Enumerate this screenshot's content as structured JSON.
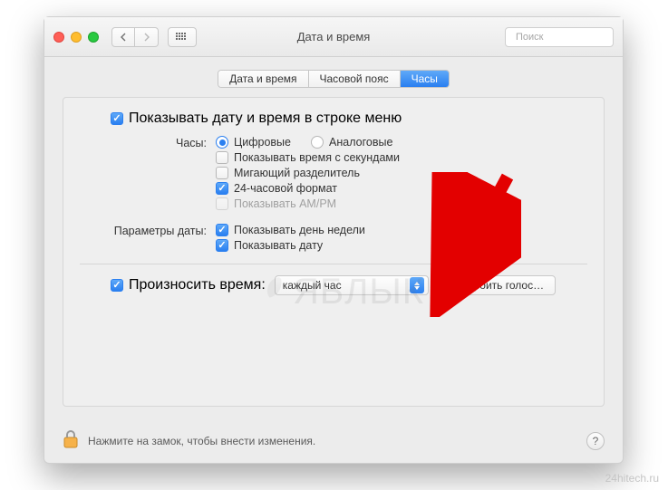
{
  "window": {
    "title": "Дата и время"
  },
  "search": {
    "placeholder": "Поиск"
  },
  "tabs": {
    "items": [
      "Дата и время",
      "Часовой пояс",
      "Часы"
    ],
    "active_index": 2
  },
  "menubar": {
    "show_label": "Показывать дату и время в строке меню"
  },
  "clock": {
    "label": "Часы:",
    "digital_label": "Цифровые",
    "analog_label": "Аналоговые",
    "show_seconds_label": "Показывать время с секундами",
    "flash_separators_label": "Мигающий разделитель",
    "twentyfour_label": "24-часовой формат",
    "ampm_label": "Показывать AM/PM"
  },
  "date": {
    "label": "Параметры даты:",
    "show_weekday_label": "Показывать день недели",
    "show_date_label": "Показывать дату"
  },
  "speak": {
    "announce_label": "Произносить время:",
    "interval_selected": "каждый час",
    "customize_button": "Настроить голос…"
  },
  "footer": {
    "lock_hint": "Нажмите на замок, чтобы внести изменения."
  },
  "watermark": {
    "host": "24hitech.ru",
    "logo_text": "ЯБЛЫК"
  }
}
